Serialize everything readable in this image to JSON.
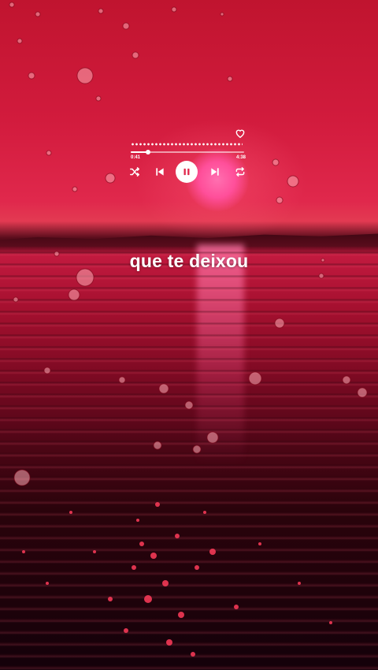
{
  "player": {
    "elapsed": "0:41",
    "total": "4:38",
    "progress": 0.15,
    "icons": {
      "like": "heart-outline-icon",
      "shuffle": "shuffle-icon",
      "previous": "skip-previous-icon",
      "playpause": "pause-icon",
      "next": "skip-next-icon",
      "repeat": "repeat-icon"
    }
  },
  "lyrics": {
    "current_line": "que te deixou"
  },
  "colors": {
    "sky": "#d21b3d",
    "sun": "#ff4f9a",
    "water": "#a5102f",
    "text": "#ffffff"
  }
}
